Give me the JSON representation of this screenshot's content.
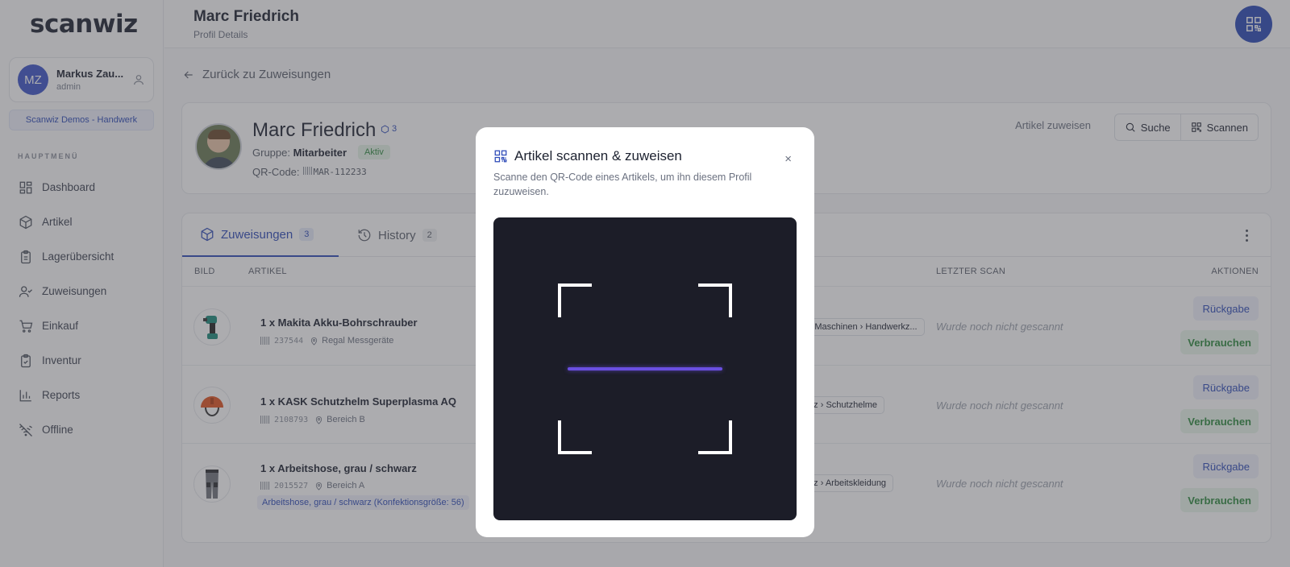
{
  "brand": {
    "logo_scan": "scan",
    "logo_wiz": "wiz"
  },
  "user": {
    "initials": "MZ",
    "name": "Markus Zau...",
    "role": "admin"
  },
  "organization": "Scanwiz Demos - Handwerk",
  "sidebar": {
    "section_label": "HAUPTMENÜ",
    "items": [
      {
        "label": "Dashboard",
        "icon": "dashboard-icon"
      },
      {
        "label": "Artikel",
        "icon": "box-icon"
      },
      {
        "label": "Lagerübersicht",
        "icon": "clipboard-icon"
      },
      {
        "label": "Zuweisungen",
        "icon": "user-check-icon"
      },
      {
        "label": "Einkauf",
        "icon": "cart-icon"
      },
      {
        "label": "Inventur",
        "icon": "checklist-icon"
      },
      {
        "label": "Reports",
        "icon": "bar-chart-icon"
      },
      {
        "label": "Offline",
        "icon": "wifi-off-icon"
      }
    ]
  },
  "header": {
    "title": "Marc Friedrich",
    "subtitle": "Profil Details"
  },
  "back_label": "Zurück zu Zuweisungen",
  "profile": {
    "name": "Marc Friedrich",
    "item_count": "3",
    "group_label": "Gruppe:",
    "group_value": "Mitarbeiter",
    "status": "Aktiv",
    "qr_label": "QR-Code:",
    "qr_value": "MAR-112233",
    "assign_label": "Artikel zuweisen",
    "search_label": "Suche",
    "scan_label": "Scannen"
  },
  "tabs": [
    {
      "label": "Zuweisungen",
      "count": "3"
    },
    {
      "label": "History",
      "count": "2"
    }
  ],
  "table": {
    "headers": {
      "image": "BILD",
      "article": "ARTIKEL",
      "last_scan": "LETZTER SCAN",
      "actions": "AKTIONEN"
    },
    "rows": [
      {
        "title": "1 x Makita Akku-Bohrschrauber",
        "code": "237544",
        "location": "Regal Messgeräte",
        "variant": "",
        "category": "& Maschinen › Handwerkz...",
        "last_scan": "Wurde noch nicht gescannt",
        "return_label": "Rückgabe",
        "consume_label": "Verbrauchen"
      },
      {
        "title": "1 x KASK Schutzhelm Superplasma AQ",
        "code": "2108793",
        "location": "Bereich B",
        "variant": "",
        "category": "utz › Schutzhelme",
        "last_scan": "Wurde noch nicht gescannt",
        "return_label": "Rückgabe",
        "consume_label": "Verbrauchen"
      },
      {
        "title": "1 x Arbeitshose, grau / schwarz",
        "code": "2015527",
        "location": "Bereich A",
        "variant": "Arbeitshose, grau / schwarz (Konfektionsgröße: 56)",
        "category": "utz › Arbeitskleidung",
        "last_scan": "Wurde noch nicht gescannt",
        "return_label": "Rückgabe",
        "consume_label": "Verbrauchen"
      }
    ]
  },
  "modal": {
    "title": "Artikel scannen & zuweisen",
    "description": "Scanne den QR-Code eines Artikels, um ihn diesem Profil zuzuweisen.",
    "close": "×"
  },
  "colors": {
    "accent": "#2e4bb8",
    "success": "#2e8a3f",
    "scan_line": "#6a4fe0",
    "scanner_bg": "#1c1d28"
  }
}
